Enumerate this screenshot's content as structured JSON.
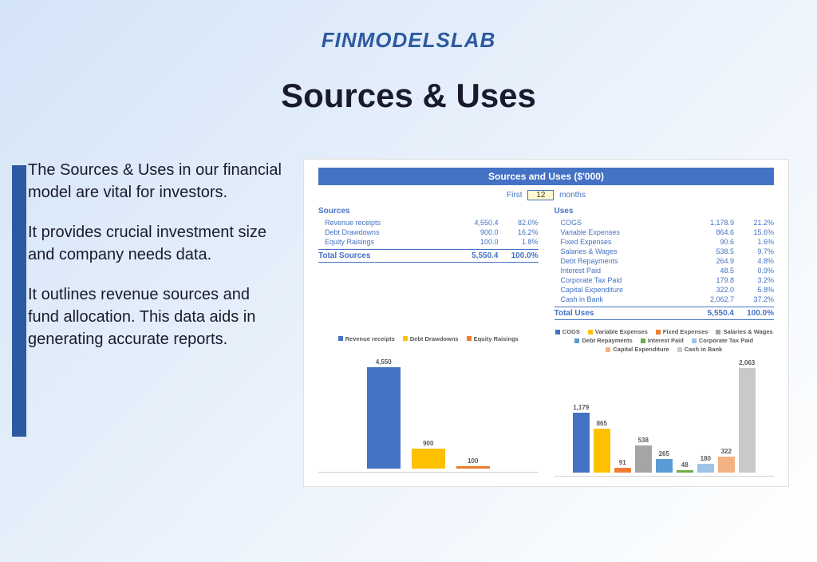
{
  "logo": "FINMODELSLAB",
  "title": "Sources & Uses",
  "paragraphs": [
    "The Sources & Uses in our financial model are vital for investors.",
    "It provides crucial investment size and company needs data.",
    "It outlines revenue sources and fund allocation. This data aids in generating accurate reports."
  ],
  "table": {
    "title": "Sources and Uses ($'000)",
    "period_prefix": "First",
    "period_value": "12",
    "period_suffix": "months",
    "sources_header": "Sources",
    "uses_header": "Uses",
    "sources": [
      {
        "label": "Revenue receipts",
        "value": "4,550.4",
        "pct": "82.0%"
      },
      {
        "label": "Debt Drawdowns",
        "value": "900.0",
        "pct": "16.2%"
      },
      {
        "label": "Equity Raisings",
        "value": "100.0",
        "pct": "1.8%"
      }
    ],
    "uses": [
      {
        "label": "COGS",
        "value": "1,178.9",
        "pct": "21.2%"
      },
      {
        "label": "Variable Expenses",
        "value": "864.6",
        "pct": "15.6%"
      },
      {
        "label": "Fixed Expenses",
        "value": "90.6",
        "pct": "1.6%"
      },
      {
        "label": "Salaries & Wages",
        "value": "538.5",
        "pct": "9.7%"
      },
      {
        "label": "Debt Repayments",
        "value": "264.9",
        "pct": "4.8%"
      },
      {
        "label": "Interest Paid",
        "value": "48.5",
        "pct": "0.9%"
      },
      {
        "label": "Corporate Tax Paid",
        "value": "179.8",
        "pct": "3.2%"
      },
      {
        "label": "Capital Expenditure",
        "value": "322.0",
        "pct": "5.8%"
      },
      {
        "label": "Cash in Bank",
        "value": "2,062.7",
        "pct": "37.2%"
      }
    ],
    "total_sources_label": "Total Sources",
    "total_sources_value": "5,550.4",
    "total_sources_pct": "100.0%",
    "total_uses_label": "Total Uses",
    "total_uses_value": "5,550.4",
    "total_uses_pct": "100.0%"
  },
  "chart_data": [
    {
      "type": "bar",
      "title": "Sources",
      "categories": [
        "Revenue receipts",
        "Debt Drawdowns",
        "Equity Raisings"
      ],
      "values": [
        4550,
        900,
        100
      ],
      "labels": [
        "4,550",
        "900",
        "100"
      ],
      "colors": [
        "#4472c4",
        "#ffc000",
        "#ed7d31"
      ],
      "ylim": [
        0,
        5000
      ]
    },
    {
      "type": "bar",
      "title": "Uses",
      "categories": [
        "COGS",
        "Variable Expenses",
        "Fixed Expenses",
        "Salaries & Wages",
        "Debt Repayments",
        "Interest Paid",
        "Corporate Tax Paid",
        "Capital Expenditure",
        "Cash in Bank"
      ],
      "values": [
        1179,
        865,
        91,
        538,
        265,
        48,
        180,
        322,
        2063
      ],
      "labels": [
        "1,179",
        "865",
        "91",
        "538",
        "265",
        "48",
        "180",
        "322",
        "2,063"
      ],
      "colors": [
        "#4472c4",
        "#ffc000",
        "#ed7d31",
        "#a5a5a5",
        "#5b9bd5",
        "#70ad47",
        "#9dc3e6",
        "#f4b183",
        "#c9c9c9"
      ],
      "ylim": [
        0,
        2200
      ]
    }
  ]
}
